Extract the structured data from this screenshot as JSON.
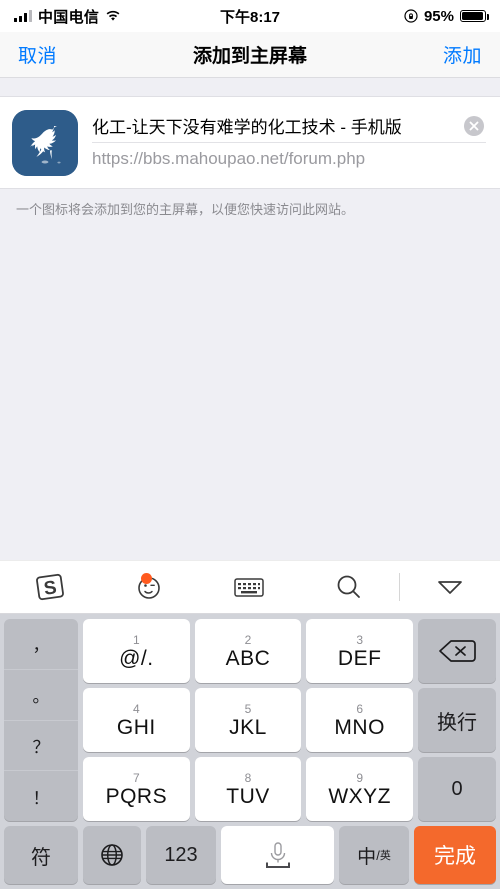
{
  "statusbar": {
    "carrier": "中国电信",
    "time": "下午8:17",
    "battery_pct": "95%",
    "signal_icon": "signal-bars-icon",
    "wifi_icon": "wifi-icon",
    "lock_icon": "rotation-lock-icon",
    "battery_icon": "battery-icon"
  },
  "navbar": {
    "cancel_label": "取消",
    "title": "添加到主屏幕",
    "add_label": "添加"
  },
  "card": {
    "app_icon_name": "horse-logo-icon",
    "title_value": "化工-让天下没有难学的化工技术 - 手机版",
    "clear_icon": "clear-text-icon",
    "url_value": "https://bbs.mahoupao.net/forum.php"
  },
  "hint": "一个图标将会添加到您的主屏幕，以便您快速访问此网站。",
  "keyboard": {
    "toolbar": [
      {
        "name": "sogou-logo-icon",
        "label": "S"
      },
      {
        "name": "emoji-icon",
        "label": ""
      },
      {
        "name": "keyboard-switch-icon",
        "label": ""
      },
      {
        "name": "search-icon",
        "label": ""
      },
      {
        "name": "collapse-keyboard-icon",
        "label": ""
      }
    ],
    "punctuation": [
      "，",
      "。",
      "？",
      "！"
    ],
    "keys": [
      {
        "num": "1",
        "label": "@/."
      },
      {
        "num": "2",
        "label": "ABC"
      },
      {
        "num": "3",
        "label": "DEF"
      },
      {
        "num": "4",
        "label": "GHI"
      },
      {
        "num": "5",
        "label": "JKL"
      },
      {
        "num": "6",
        "label": "MNO"
      },
      {
        "num": "7",
        "label": "PQRS"
      },
      {
        "num": "8",
        "label": "TUV"
      },
      {
        "num": "9",
        "label": "WXYZ"
      }
    ],
    "right_keys": [
      {
        "name": "backspace-key",
        "label": ""
      },
      {
        "name": "newline-key",
        "label": "换行"
      },
      {
        "name": "zero-key",
        "label": "0"
      }
    ],
    "bottom": {
      "symbol_label": "符",
      "globe_icon": "globe-icon",
      "numeric_label": "123",
      "space_icon": "microphone-icon",
      "lang_main": "中",
      "lang_sub": "英",
      "done_label": "完成"
    }
  },
  "colors": {
    "accent_blue": "#007AFF",
    "done_orange": "#F4692C",
    "badge_orange": "#FF5A1F",
    "app_icon_blue": "#2E5C8A",
    "keyboard_bg": "#D1D3D9"
  }
}
